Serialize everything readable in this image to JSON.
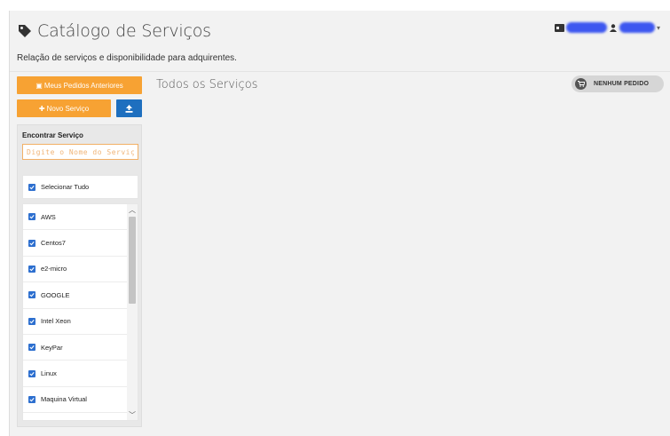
{
  "header": {
    "title": "Catálogo de Serviços",
    "subtitle": "Relação de serviços e disponibilidade para adquirentes."
  },
  "sidebar": {
    "previous_orders_label": "Meus Pedidos Anteriores",
    "new_service_label": "Novo Serviço",
    "find_label": "Encontrar Serviço",
    "search_placeholder": "Digite o Nome do Serviço",
    "select_all_label": "Selecionar Tudo",
    "items": [
      {
        "label": "AWS"
      },
      {
        "label": "Centos7"
      },
      {
        "label": "e2-micro"
      },
      {
        "label": "GOOGLE"
      },
      {
        "label": "Intel Xeon"
      },
      {
        "label": "KeyPar"
      },
      {
        "label": "Linux"
      },
      {
        "label": "Maquina Virtual"
      }
    ]
  },
  "main": {
    "title": "Todos os Serviços",
    "orders_badge": "NENHUM PEDIDO"
  },
  "colors": {
    "accent_orange": "#f7a233",
    "accent_blue": "#1e6fbf",
    "checkbox_blue": "#2d6fcf",
    "redaction_blue": "#3d57f0"
  },
  "icons": [
    "tag-icon",
    "id-card-icon",
    "user-icon",
    "chevron-down-icon",
    "upload-icon",
    "checkbox-icon",
    "cart-icon"
  ]
}
